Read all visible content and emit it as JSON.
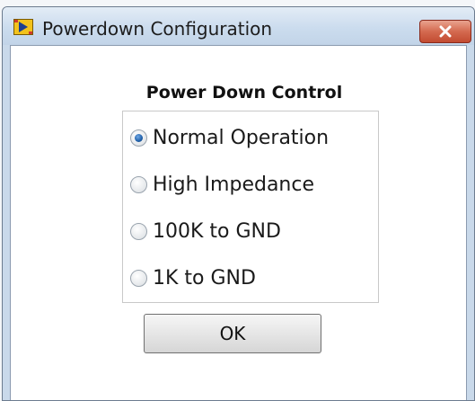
{
  "window": {
    "title": "Powerdown Configuration",
    "icon": "labview-vi-icon",
    "close_icon": "close-x-icon"
  },
  "power_down_control": {
    "heading": "Power Down Control",
    "selected": "Normal Operation",
    "options": [
      {
        "label": "Normal Operation",
        "checked": true
      },
      {
        "label": "High Impedance",
        "checked": false
      },
      {
        "label": "100K to GND",
        "checked": false
      },
      {
        "label": "1K to GND",
        "checked": false
      }
    ]
  },
  "buttons": {
    "ok_label": "OK"
  },
  "colors": {
    "titlebar": "#cbdcee",
    "close_button": "#d46a50",
    "radio_selected": "#1f5fa8"
  }
}
